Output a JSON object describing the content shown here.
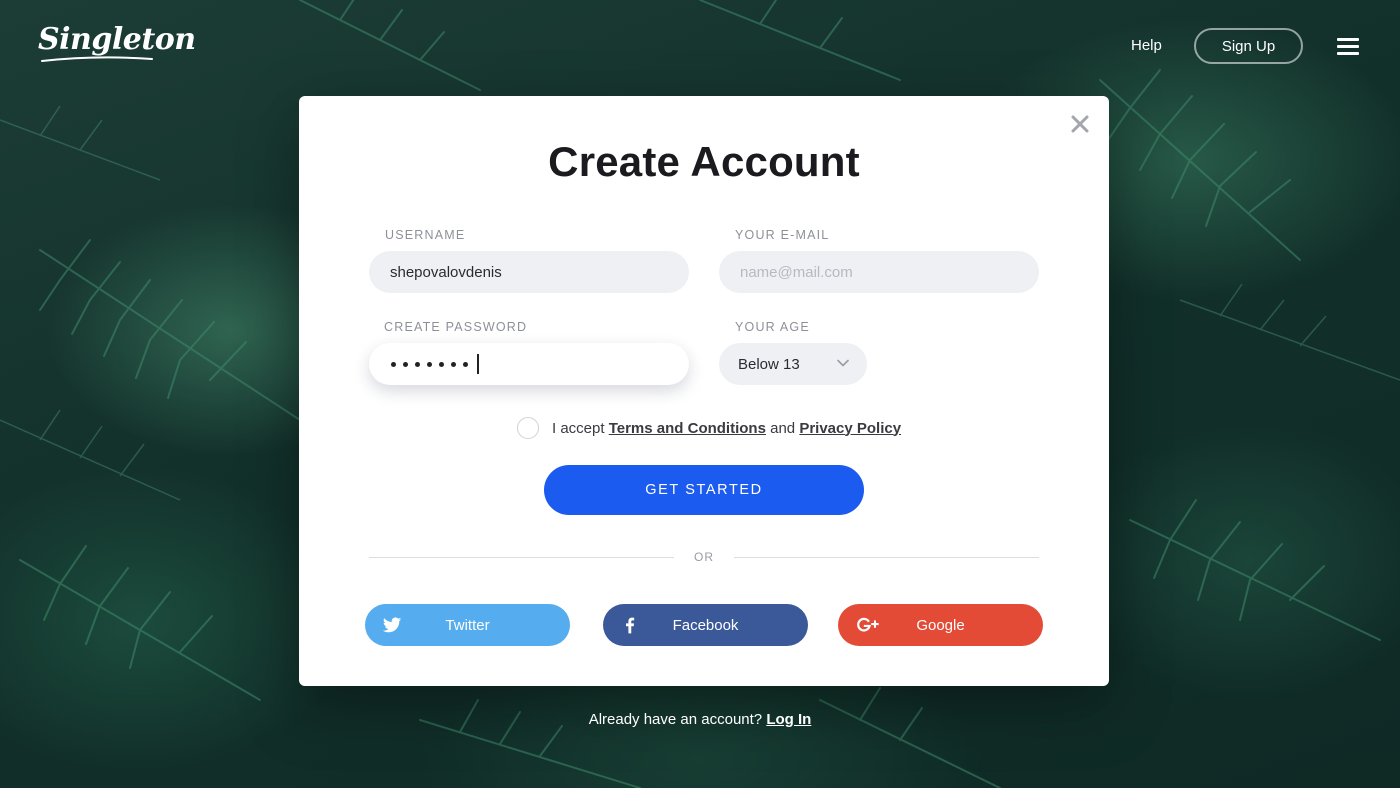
{
  "header": {
    "logo_text": "Singleton",
    "help_label": "Help",
    "signup_label": "Sign Up",
    "menu_icon": "hamburger-menu-icon"
  },
  "modal": {
    "title": "Create Account",
    "close_icon": "close-icon",
    "username": {
      "label": "USERNAME",
      "value": "shepovalovdenis"
    },
    "email": {
      "label": "YOUR E-MAIL",
      "value": "",
      "placeholder": "name@mail.com"
    },
    "password": {
      "label": "CREATE PASSWORD",
      "masked_length": 7
    },
    "age": {
      "label": "YOUR AGE",
      "selected": "Below 13"
    },
    "agree": {
      "prefix": "I accept",
      "terms_link": "Terms and Conditions",
      "middle": "and",
      "privacy_link": "Privacy Policy",
      "checked": false
    },
    "cta_label": "GET STARTED",
    "or_label": "OR",
    "social": {
      "twitter": "Twitter",
      "facebook": "Facebook",
      "google": "Google"
    }
  },
  "footer": {
    "prompt": "Already have an account?",
    "login_link": "Log In"
  },
  "colors": {
    "primary": "#1b5bef",
    "twitter": "#55acee",
    "facebook": "#3b5898",
    "google": "#e34b37"
  }
}
